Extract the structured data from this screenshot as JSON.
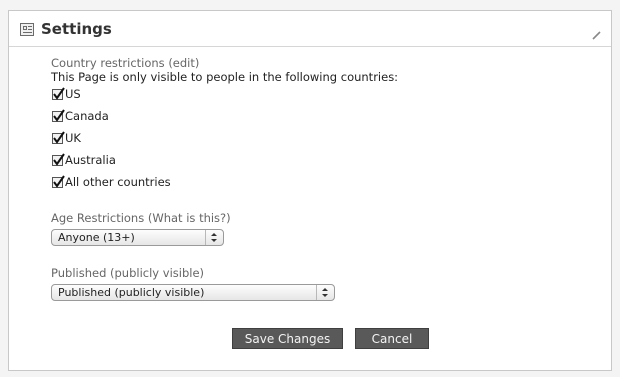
{
  "header": {
    "title": "Settings",
    "icon": "settings-panel-icon",
    "edit_icon": "pencil-icon"
  },
  "country": {
    "label": "Country restrictions (edit)",
    "description": "This Page is only visible to people in the following countries:",
    "options": [
      {
        "label": "US",
        "checked": true
      },
      {
        "label": "Canada",
        "checked": true
      },
      {
        "label": "UK",
        "checked": true
      },
      {
        "label": "Australia",
        "checked": true
      },
      {
        "label": "All other countries",
        "checked": true
      }
    ]
  },
  "age": {
    "label": "Age Restrictions (What is this?)",
    "selected": "Anyone (13+)"
  },
  "published": {
    "label": "Published (publicly visible)",
    "selected": "Published (publicly visible)"
  },
  "actions": {
    "save_label": "Save Changes",
    "cancel_label": "Cancel"
  },
  "colors": {
    "button_bg": "#595959",
    "panel_bg": "#ffffff",
    "page_bg": "#f4f4f4"
  }
}
